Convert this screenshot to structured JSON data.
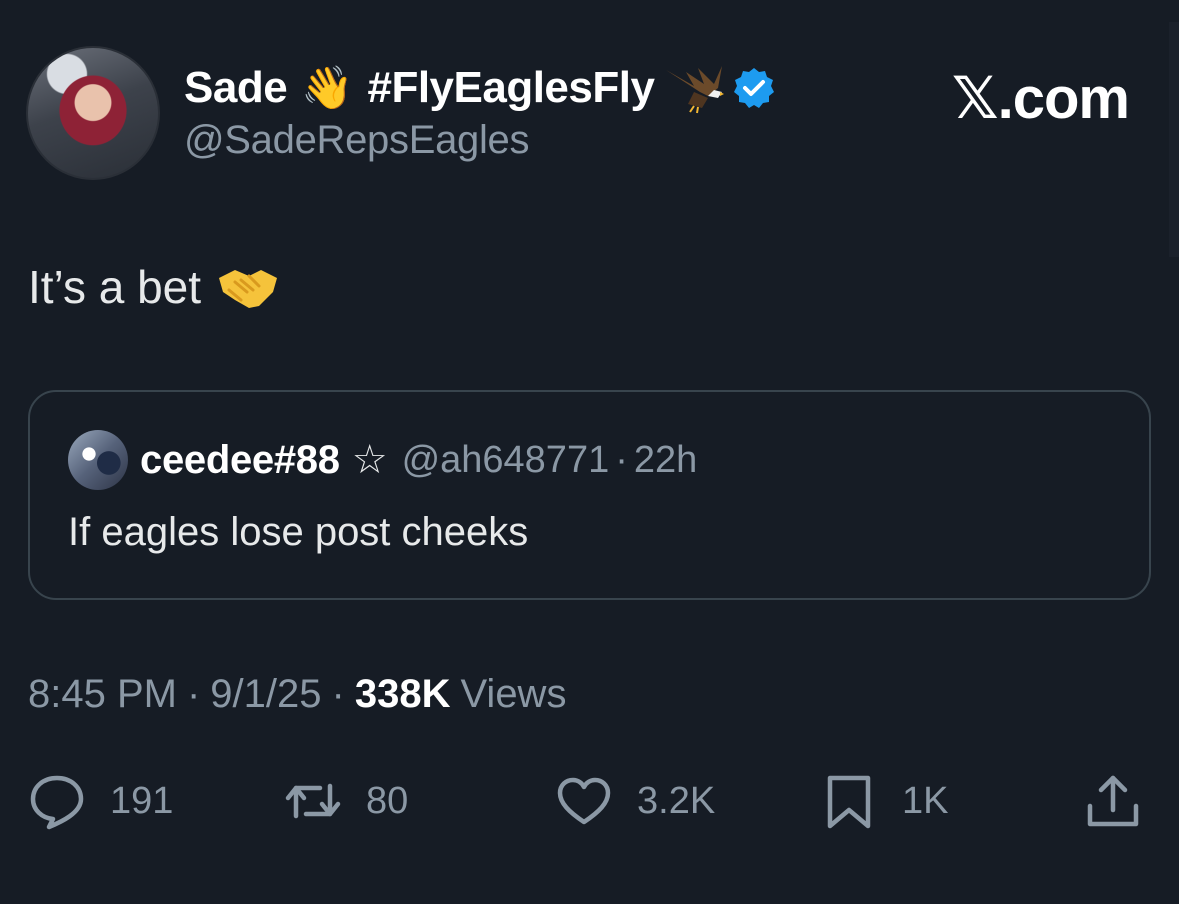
{
  "author": {
    "display_name": "Sade",
    "wave_emoji": "👋",
    "hashtag": "#FlyEaglesFly",
    "handle": "@SadeRepsEagles",
    "eagle_icon": "eagle-icon",
    "verified_icon": "verified-badge-icon"
  },
  "brand": {
    "label": "𝕏.com"
  },
  "tweet": {
    "text": "It’s a bet",
    "emoji_icon": "handshake-icon"
  },
  "quote": {
    "name": "ceedee#88",
    "star": "☆",
    "handle": "@ah648771",
    "separator": "·",
    "time": "22h",
    "text": "If eagles lose post cheeks"
  },
  "meta": {
    "time": "8:45 PM",
    "sep1": "·",
    "date": "9/1/25",
    "sep2": "·",
    "views_count": "338K",
    "views_label": "Views"
  },
  "actions": {
    "reply_count": "191",
    "repost_count": "80",
    "like_count": "3.2K",
    "bookmark_count": "1K"
  },
  "colors": {
    "background": "#161c25",
    "text": "#e7e9ea",
    "muted": "#8b98a5",
    "verified": "#1d9bf0",
    "border": "#38444d"
  }
}
